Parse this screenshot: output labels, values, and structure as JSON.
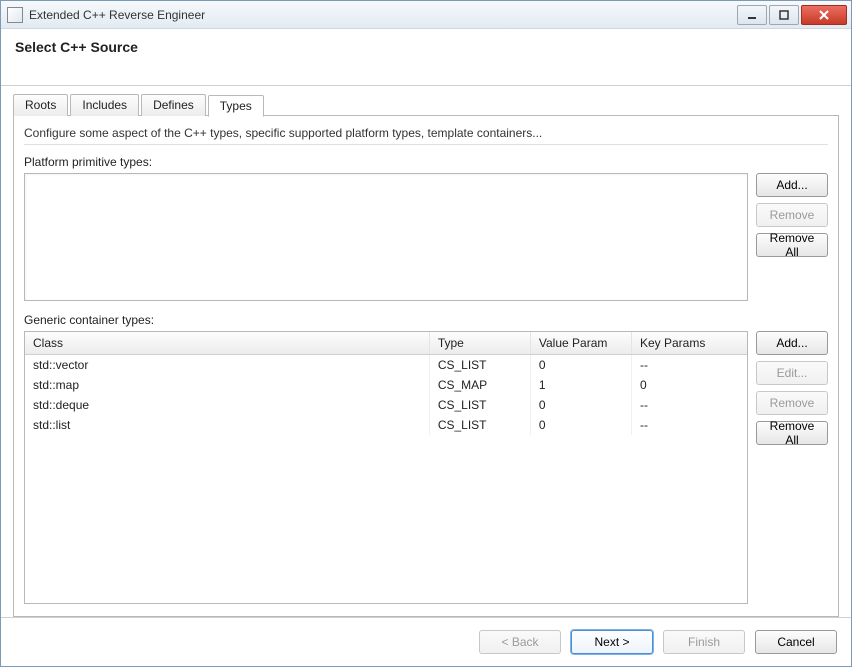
{
  "window": {
    "title": "Extended C++ Reverse Engineer"
  },
  "header": {
    "title": "Select C++ Source"
  },
  "tabs": {
    "items": [
      {
        "label": "Roots"
      },
      {
        "label": "Includes"
      },
      {
        "label": "Defines"
      },
      {
        "label": "Types"
      }
    ],
    "active_index": 3
  },
  "panel": {
    "description": "Configure some aspect of the C++ types, specific supported platform types, template containers...",
    "primitive_label": "Platform primitive types:",
    "primitive_buttons": {
      "add": "Add...",
      "remove": "Remove",
      "remove_all": "Remove All"
    },
    "container_label": "Generic container types:",
    "container_buttons": {
      "add": "Add...",
      "edit": "Edit...",
      "remove": "Remove",
      "remove_all": "Remove All"
    },
    "table": {
      "headers": {
        "class": "Class",
        "type": "Type",
        "value_param": "Value Param",
        "key_params": "Key Params"
      },
      "rows": [
        {
          "class": "std::vector",
          "type": "CS_LIST",
          "value_param": "0",
          "key_params": "--"
        },
        {
          "class": "std::map",
          "type": "CS_MAP",
          "value_param": "1",
          "key_params": "0"
        },
        {
          "class": "std::deque",
          "type": "CS_LIST",
          "value_param": "0",
          "key_params": "--"
        },
        {
          "class": "std::list",
          "type": "CS_LIST",
          "value_param": "0",
          "key_params": "--"
        }
      ]
    }
  },
  "footer": {
    "back": "< Back",
    "next": "Next >",
    "finish": "Finish",
    "cancel": "Cancel"
  }
}
